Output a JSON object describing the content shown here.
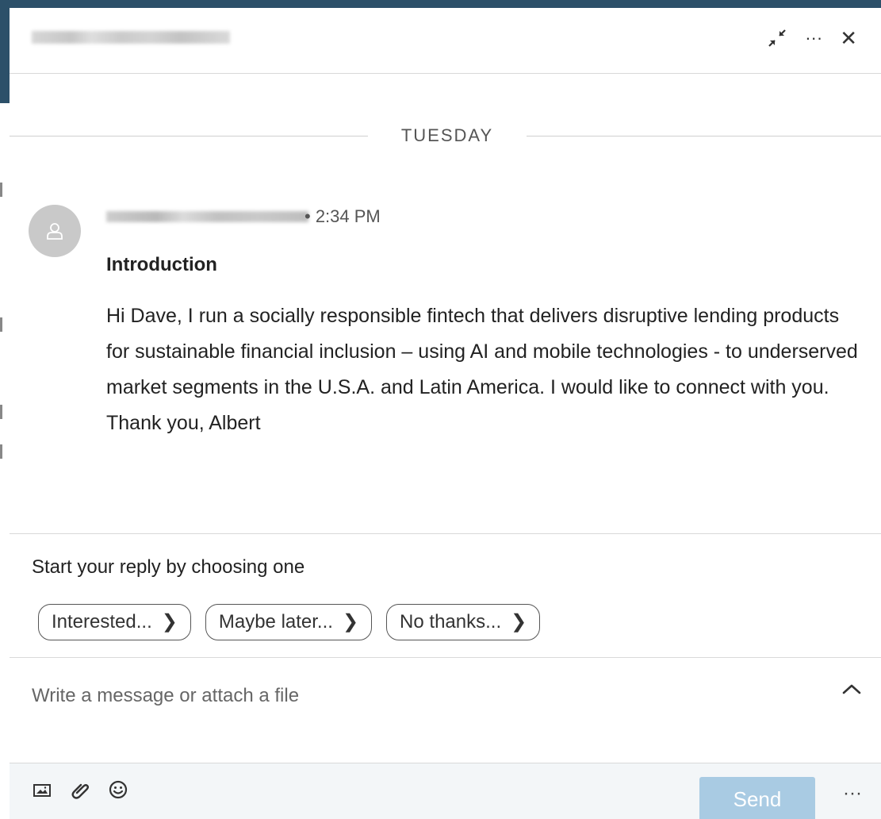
{
  "header": {
    "minimize_icon": "minimize-icon",
    "more_label": "···",
    "close_label": "✕"
  },
  "conversation": {
    "date_divider": "TUESDAY",
    "message": {
      "time": "• 2:34 PM",
      "subject": "Introduction",
      "body": "Hi Dave, I run a socially responsible fintech that delivers disruptive lending products for sustainable financial inclusion – using AI and mobile technologies - to underserved market segments in the U.S.A. and Latin America. I would like to connect with you. Thank you, Albert"
    }
  },
  "quick_replies": {
    "prompt": "Start your reply by choosing one",
    "options": [
      {
        "label": "Interested...",
        "arrow": "❯"
      },
      {
        "label": "Maybe later...",
        "arrow": "❯"
      },
      {
        "label": "No thanks...",
        "arrow": "❯"
      }
    ]
  },
  "compose": {
    "placeholder": "Write a message or attach a file",
    "expand_icon": "chevron-up-icon"
  },
  "footer": {
    "send_label": "Send",
    "more_label": "···"
  },
  "colors": {
    "send_disabled": "#a9cbe3",
    "background": "#2c5069"
  }
}
